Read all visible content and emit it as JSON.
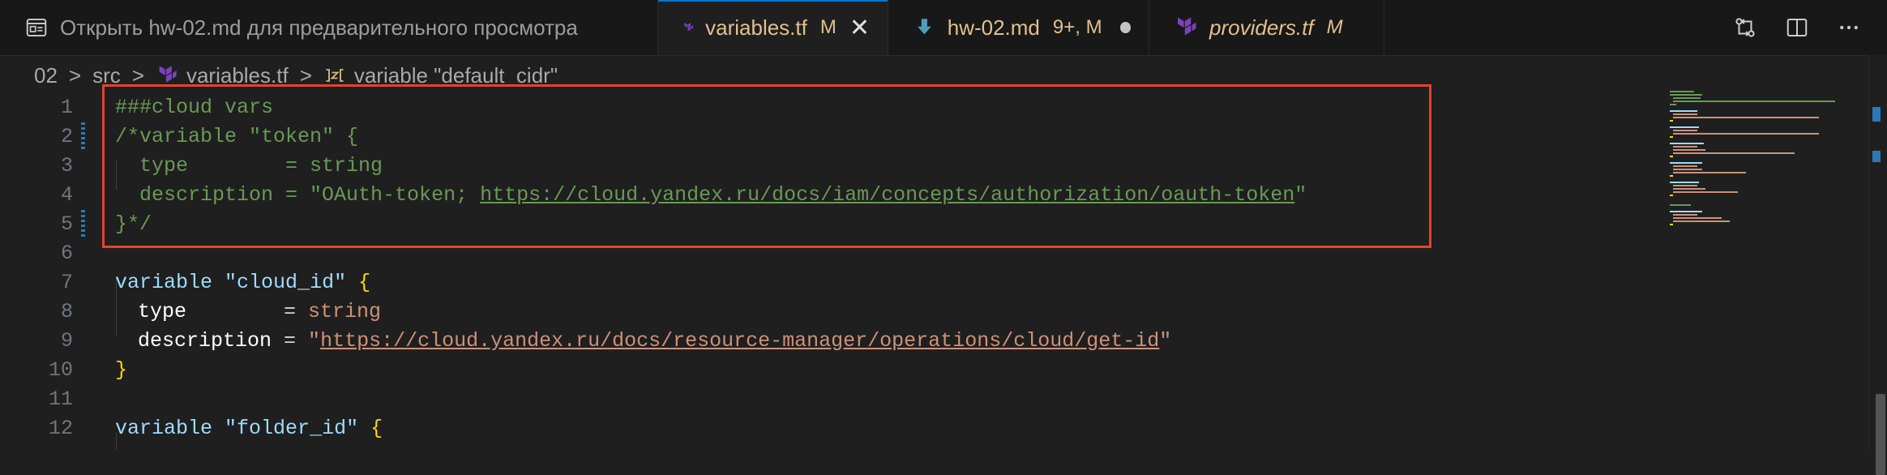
{
  "tabs": [
    {
      "label": "Открыть hw-02.md для предварительного просмотра",
      "icon": "preview-icon"
    },
    {
      "label": "variables.tf",
      "status": "M",
      "icon": "terraform-icon",
      "close": "✕"
    },
    {
      "label": "hw-02.md",
      "status": "9+, M",
      "icon": "markdown-download-icon"
    },
    {
      "label": "providers.tf",
      "status": "M",
      "icon": "terraform-icon"
    }
  ],
  "breadcrumb": {
    "items": [
      "02",
      "src",
      "variables.tf",
      "variable \"default_cidr\""
    ],
    "separator": ">"
  },
  "editor": {
    "line_numbers": [
      "1",
      "2",
      "3",
      "4",
      "5",
      "6",
      "7",
      "8",
      "9",
      "10",
      "11",
      "12"
    ],
    "lines": {
      "l1": "###cloud vars",
      "l2": "/*variable \"token\" {",
      "l3_key": "  type        = string",
      "l4_pre": "  description = \"OAuth-token; ",
      "l4_link": "https://cloud.yandex.ru/docs/iam/concepts/authorization/oauth-token",
      "l4_post": "\"",
      "l5": "}*/",
      "l7_kw": "variable",
      "l7_name": "\"cloud_id\"",
      "l7_brace": "{",
      "l8_key": "type",
      "l8_eq": "        = ",
      "l8_val": "string",
      "l9_key": "description",
      "l9_eq": " = ",
      "l9_q1": "\"",
      "l9_link": "https://cloud.yandex.ru/docs/resource-manager/operations/cloud/get-id",
      "l9_q2": "\"",
      "l10": "}",
      "l12_kw": "variable",
      "l12_name": "\"folder_id\"",
      "l12_brace": "{"
    }
  },
  "colors": {
    "accent": "#0078d4",
    "highlight_box": "#e5432c",
    "modified": "#e2c08d"
  }
}
